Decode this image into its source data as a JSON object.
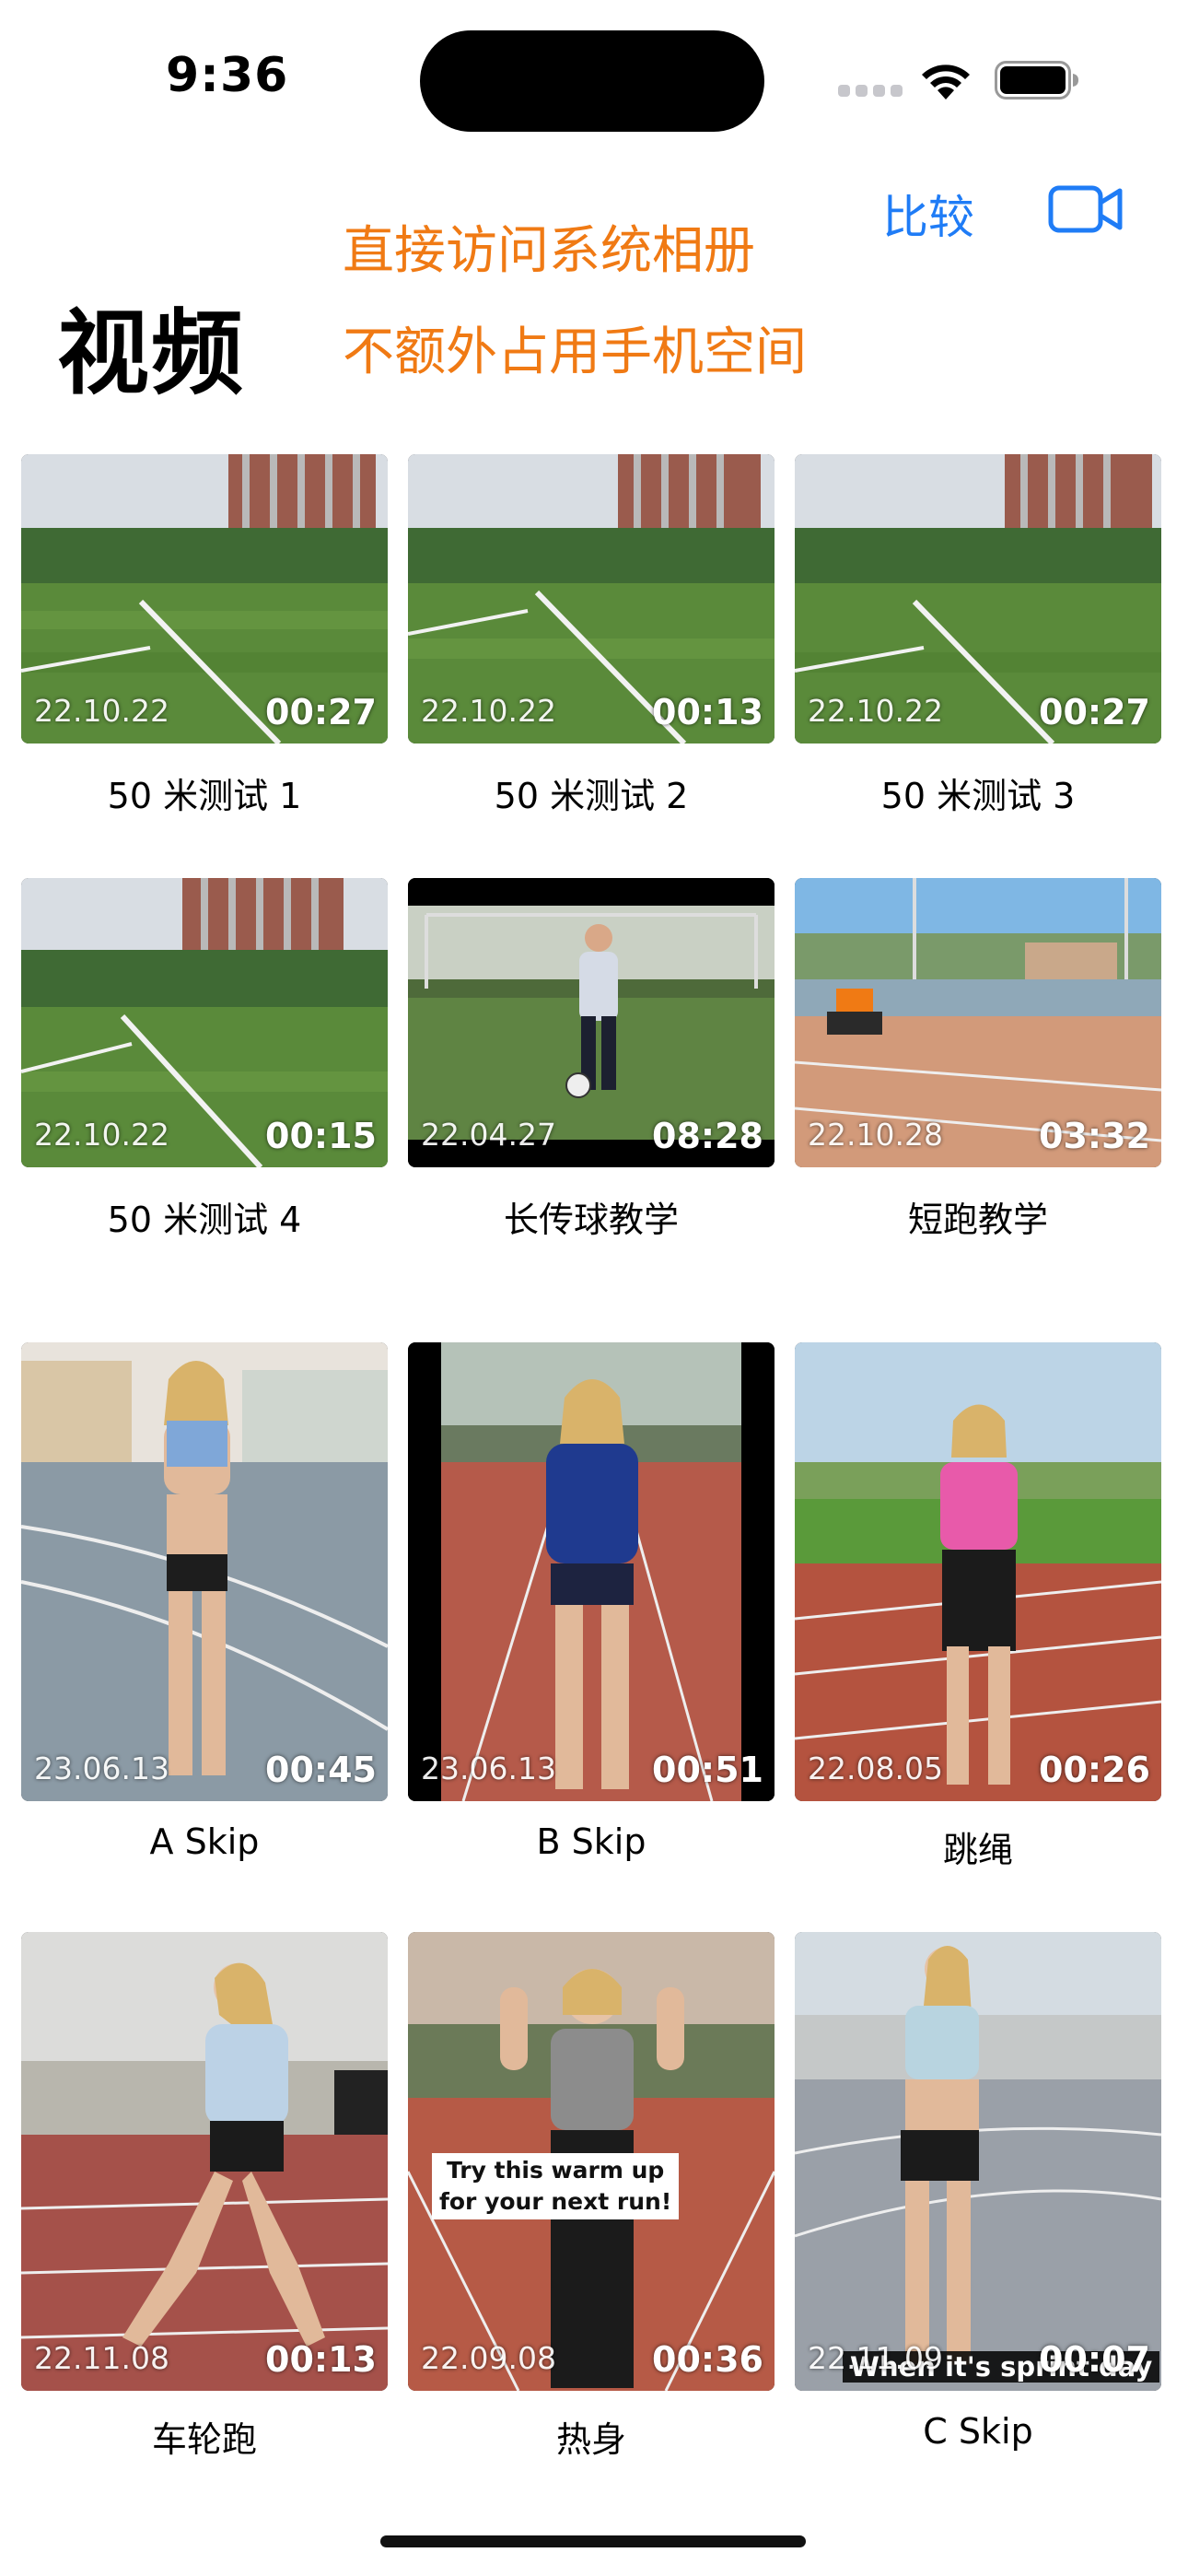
{
  "status_bar": {
    "time": "9:36"
  },
  "header": {
    "compare_label": "比较",
    "title": "视频",
    "promo_line1": "直接访问系统相册",
    "promo_line2": "不额外占用手机空间",
    "camera_icon": "video-camera-icon",
    "promo_color": "#f07a14",
    "accent_color": "#1f7cf6"
  },
  "videos": [
    {
      "date": "22.10.22",
      "duration": "00:27",
      "title": "50 米测试 1"
    },
    {
      "date": "22.10.22",
      "duration": "00:13",
      "title": "50 米测试 2"
    },
    {
      "date": "22.10.22",
      "duration": "00:27",
      "title": "50 米测试 3"
    },
    {
      "date": "22.10.22",
      "duration": "00:15",
      "title": "50 米测试 4"
    },
    {
      "date": "22.04.27",
      "duration": "08:28",
      "title": "长传球教学"
    },
    {
      "date": "22.10.28",
      "duration": "03:32",
      "title": "短跑教学"
    },
    {
      "date": "23.06.13",
      "duration": "00:45",
      "title": "A Skip"
    },
    {
      "date": "23.06.13",
      "duration": "00:51",
      "title": "B Skip"
    },
    {
      "date": "22.08.05",
      "duration": "00:26",
      "title": "跳绳"
    },
    {
      "date": "22.11.08",
      "duration": "00:13",
      "title": "车轮跑"
    },
    {
      "date": "22.09.08",
      "duration": "00:36",
      "title": "热身",
      "overlay_line1": "Try this warm up",
      "overlay_line2": "for your next run!"
    },
    {
      "date": "22.11.09",
      "duration": "00:07",
      "title": "C Skip",
      "overlay": "When it's sprint day"
    }
  ]
}
